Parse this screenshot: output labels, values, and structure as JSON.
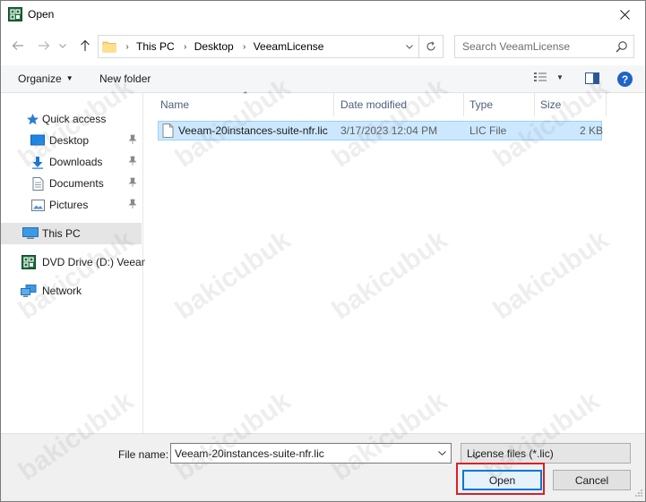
{
  "window": {
    "title": "Open"
  },
  "nav": {
    "breadcrumbs": [
      "This PC",
      "Desktop",
      "VeeamLicense"
    ],
    "search_placeholder": "Search VeeamLicense"
  },
  "toolbar": {
    "organize_label": "Organize",
    "new_folder_label": "New folder"
  },
  "sidebar": {
    "items": [
      {
        "label": "Quick access",
        "icon": "star-icon"
      },
      {
        "label": "Desktop",
        "icon": "desktop-folder-icon",
        "pinned": true
      },
      {
        "label": "Downloads",
        "icon": "download-arrow-icon",
        "pinned": true
      },
      {
        "label": "Documents",
        "icon": "document-icon",
        "pinned": true
      },
      {
        "label": "Pictures",
        "icon": "picture-icon",
        "pinned": true
      },
      {
        "label": "This PC",
        "icon": "computer-icon",
        "selected": true
      },
      {
        "label": "DVD Drive (D:) Veeam",
        "icon": "disc-drive-icon"
      },
      {
        "label": "Network",
        "icon": "network-icon"
      }
    ]
  },
  "file_list": {
    "columns": [
      "Name",
      "Date modified",
      "Type",
      "Size"
    ],
    "rows": [
      {
        "name": "Veeam-20instances-suite-nfr.lic",
        "date_modified": "3/17/2023 12:04 PM",
        "type": "LIC File",
        "size": "2 KB",
        "selected": true
      }
    ]
  },
  "footer": {
    "file_name_label": "File name:",
    "file_name_value": "Veeam-20instances-suite-nfr.lic",
    "file_type_value": "License files (*.lic)",
    "open_label": "Open",
    "cancel_label": "Cancel"
  },
  "watermark": {
    "text": "bakicubuk"
  },
  "colors": {
    "accent": "#0078d7",
    "selection": "#cce8ff",
    "highlight_frame": "#d9202a",
    "help": "#1e63c7"
  }
}
